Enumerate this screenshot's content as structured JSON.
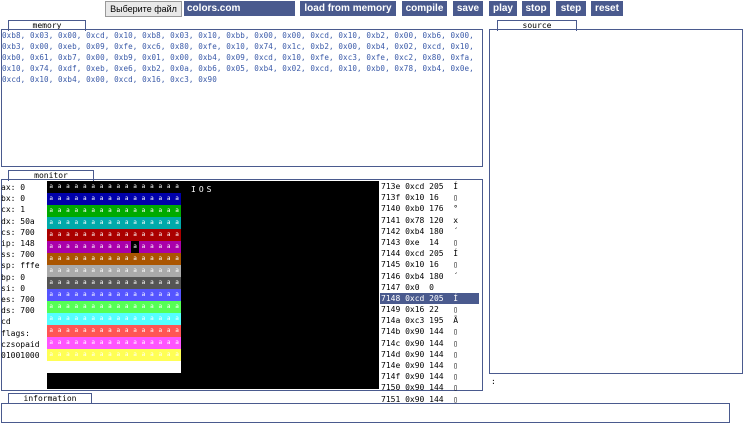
{
  "toolbar": {
    "file_button_label": "Выберите файл",
    "file_name": "colors.com",
    "buttons": {
      "load": "load from memory",
      "compile": "compile",
      "save": "save",
      "play": "play",
      "stop": "stop",
      "step": "step",
      "reset": "reset"
    }
  },
  "colors": {
    "accent": "#4a5a8e",
    "memory_text": "#3a5aa8"
  },
  "memory": {
    "title": "memory",
    "bytes": "0xb8, 0x03, 0x00, 0xcd, 0x10, 0xb8, 0x03, 0x10, 0xbb, 0x00, 0x00, 0xcd, 0x10, 0xb2, 0x00, 0xb6, 0x00, 0xb3, 0x00, 0xeb, 0x09, 0xfe, 0xc6, 0x80, 0xfe, 0x10, 0x74, 0x1c, 0xb2, 0x00, 0xb4, 0x02, 0xcd, 0x10, 0xb0, 0x61, 0xb7, 0x00, 0xb9, 0x01, 0x00, 0xb4, 0x09, 0xcd, 0x10, 0xfe, 0xc3, 0xfe, 0xc2, 0x80, 0xfa, 0x10, 0x74, 0xdf, 0xeb, 0xe6, 0xb2, 0x0a, 0xb6, 0x05, 0xb4, 0x02, 0xcd, 0x10, 0xb0, 0x78, 0xb4, 0x0e, 0xcd, 0x10, 0xb4, 0x00, 0xcd, 0x16, 0xc3, 0x90"
  },
  "source": {
    "title": "source"
  },
  "monitor": {
    "title": "monitor",
    "registers": [
      "ax: 0",
      "bx: 0",
      "cx: 1",
      "dx: 50a",
      "cs: 700",
      "ip: 148",
      "ss: 700",
      "sp: fffe",
      "bp: 0",
      "si: 0",
      "es: 700",
      "ds: 700",
      "cd",
      "flags:",
      "czsopaid",
      "01001000"
    ],
    "screen_text": "IOS",
    "palette_glyph": "a",
    "palette_rows": [
      [
        "#000000",
        "#000000",
        "#000000",
        "#000000",
        "#000000",
        "#000000",
        "#000000",
        "#000000",
        "#000000",
        "#000000",
        "#000000",
        "#000000",
        "#000000",
        "#000000",
        "#000000",
        "#000000"
      ],
      [
        "#0000aa",
        "#0000aa",
        "#0000aa",
        "#0000aa",
        "#0000aa",
        "#0000aa",
        "#0000aa",
        "#0000aa",
        "#0000aa",
        "#0000aa",
        "#0000aa",
        "#0000aa",
        "#0000aa",
        "#0000aa",
        "#0000aa",
        "#0000aa"
      ],
      [
        "#00aa00",
        "#00aa00",
        "#00aa00",
        "#00aa00",
        "#00aa00",
        "#00aa00",
        "#00aa00",
        "#00aa00",
        "#00aa00",
        "#00aa00",
        "#00aa00",
        "#00aa00",
        "#00aa00",
        "#00aa00",
        "#00aa00",
        "#00aa00"
      ],
      [
        "#00aaaa",
        "#00aaaa",
        "#00aaaa",
        "#00aaaa",
        "#00aaaa",
        "#00aaaa",
        "#00aaaa",
        "#00aaaa",
        "#00aaaa",
        "#00aaaa",
        "#00aaaa",
        "#00aaaa",
        "#00aaaa",
        "#00aaaa",
        "#00aaaa",
        "#00aaaa"
      ],
      [
        "#aa0000",
        "#aa0000",
        "#aa0000",
        "#aa0000",
        "#aa0000",
        "#aa0000",
        "#aa0000",
        "#aa0000",
        "#aa0000",
        "#aa0000",
        "#aa0000",
        "#aa0000",
        "#aa0000",
        "#aa0000",
        "#aa0000",
        "#aa0000"
      ],
      [
        "#aa00aa",
        "#aa00aa",
        "#aa00aa",
        "#aa00aa",
        "#aa00aa",
        "#aa00aa",
        "#aa00aa",
        "#aa00aa",
        "#aa00aa",
        "#aa00aa",
        "#000000",
        "#aa00aa",
        "#aa00aa",
        "#aa00aa",
        "#aa00aa",
        "#aa00aa"
      ],
      [
        "#aa5500",
        "#aa5500",
        "#aa5500",
        "#aa5500",
        "#aa5500",
        "#aa5500",
        "#aa5500",
        "#aa5500",
        "#aa5500",
        "#aa5500",
        "#aa5500",
        "#aa5500",
        "#aa5500",
        "#aa5500",
        "#aa5500",
        "#aa5500"
      ],
      [
        "#aaaaaa",
        "#aaaaaa",
        "#aaaaaa",
        "#aaaaaa",
        "#aaaaaa",
        "#aaaaaa",
        "#aaaaaa",
        "#aaaaaa",
        "#aaaaaa",
        "#aaaaaa",
        "#aaaaaa",
        "#aaaaaa",
        "#aaaaaa",
        "#aaaaaa",
        "#aaaaaa",
        "#aaaaaa"
      ],
      [
        "#555555",
        "#555555",
        "#555555",
        "#555555",
        "#555555",
        "#555555",
        "#555555",
        "#555555",
        "#555555",
        "#555555",
        "#555555",
        "#555555",
        "#555555",
        "#555555",
        "#555555",
        "#555555"
      ],
      [
        "#5555ff",
        "#5555ff",
        "#5555ff",
        "#5555ff",
        "#5555ff",
        "#5555ff",
        "#5555ff",
        "#5555ff",
        "#5555ff",
        "#5555ff",
        "#5555ff",
        "#5555ff",
        "#5555ff",
        "#5555ff",
        "#5555ff",
        "#5555ff"
      ],
      [
        "#55ff55",
        "#55ff55",
        "#55ff55",
        "#55ff55",
        "#55ff55",
        "#55ff55",
        "#55ff55",
        "#55ff55",
        "#55ff55",
        "#55ff55",
        "#55ff55",
        "#55ff55",
        "#55ff55",
        "#55ff55",
        "#55ff55",
        "#55ff55"
      ],
      [
        "#55ffff",
        "#55ffff",
        "#55ffff",
        "#55ffff",
        "#55ffff",
        "#55ffff",
        "#55ffff",
        "#55ffff",
        "#55ffff",
        "#55ffff",
        "#55ffff",
        "#55ffff",
        "#55ffff",
        "#55ffff",
        "#55ffff",
        "#55ffff"
      ],
      [
        "#ff5555",
        "#ff5555",
        "#ff5555",
        "#ff5555",
        "#ff5555",
        "#ff5555",
        "#ff5555",
        "#ff5555",
        "#ff5555",
        "#ff5555",
        "#ff5555",
        "#ff5555",
        "#ff5555",
        "#ff5555",
        "#ff5555",
        "#ff5555"
      ],
      [
        "#ff55ff",
        "#ff55ff",
        "#ff55ff",
        "#ff55ff",
        "#ff55ff",
        "#ff55ff",
        "#ff55ff",
        "#ff55ff",
        "#ff55ff",
        "#ff55ff",
        "#ff55ff",
        "#ff55ff",
        "#ff55ff",
        "#ff55ff",
        "#ff55ff",
        "#ff55ff"
      ],
      [
        "#ffff55",
        "#ffff55",
        "#ffff55",
        "#ffff55",
        "#ffff55",
        "#ffff55",
        "#ffff55",
        "#ffff55",
        "#ffff55",
        "#ffff55",
        "#ffff55",
        "#ffff55",
        "#ffff55",
        "#ffff55",
        "#ffff55",
        "#ffff55"
      ],
      [
        "#ffffff",
        "#ffffff",
        "#ffffff",
        "#ffffff",
        "#ffffff",
        "#ffffff",
        "#ffffff",
        "#ffffff",
        "#ffffff",
        "#ffffff",
        "#ffffff",
        "#ffffff",
        "#ffffff",
        "#ffffff",
        "#ffffff",
        "#ffffff"
      ]
    ],
    "disassembly": [
      {
        "text": "713e 0xcd 205  Í",
        "active": false
      },
      {
        "text": "713f 0x10 16   ▯",
        "active": false
      },
      {
        "text": "7140 0xb0 176  °",
        "active": false
      },
      {
        "text": "7141 0x78 120  x",
        "active": false
      },
      {
        "text": "7142 0xb4 180  ´",
        "active": false
      },
      {
        "text": "7143 0xe  14   ▯",
        "active": false
      },
      {
        "text": "7144 0xcd 205  Í",
        "active": false
      },
      {
        "text": "7145 0x10 16   ▯",
        "active": false
      },
      {
        "text": "7146 0xb4 180  ´",
        "active": false
      },
      {
        "text": "7147 0x0  0",
        "active": false
      },
      {
        "text": "7148 0xcd 205  Í",
        "active": true
      },
      {
        "text": "7149 0x16 22   ▯",
        "active": false
      },
      {
        "text": "714a 0xc3 195  Ã",
        "active": false
      },
      {
        "text": "714b 0x90 144  ▯",
        "active": false
      },
      {
        "text": "714c 0x90 144  ▯",
        "active": false
      },
      {
        "text": "714d 0x90 144  ▯",
        "active": false
      },
      {
        "text": "714e 0x90 144  ▯",
        "active": false
      },
      {
        "text": "714f 0x90 144  ▯",
        "active": false
      },
      {
        "text": "7150 0x90 144  ▯",
        "active": false
      },
      {
        "text": "7151 0x90 144  ▯",
        "active": false
      }
    ],
    "status_char": ":"
  },
  "information": {
    "title": "information",
    "value": ""
  }
}
